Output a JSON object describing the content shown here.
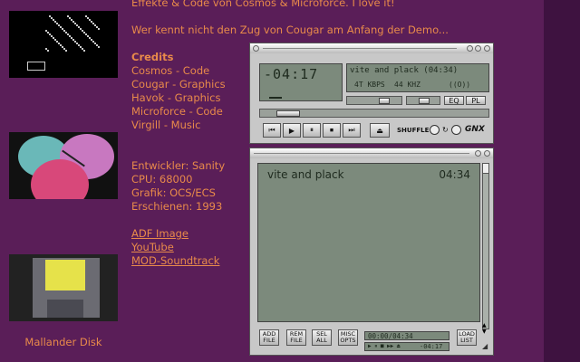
{
  "intro": {
    "line1": "Effekte & Code von Cosmos & Microforce. I love it!",
    "line2": "Wer kennt nicht den Zug von Cougar am Anfang der Demo..."
  },
  "credits": {
    "title": "Credits",
    "items": [
      "Cosmos - Code",
      "Cougar - Graphics",
      "Havok - Graphics",
      "Microforce - Code",
      "Virgill - Music"
    ]
  },
  "info": {
    "items": [
      "Entwickler: Sanity",
      "CPU: 68000",
      "Grafik: OCS/ECS",
      "Erschienen: 1993"
    ]
  },
  "links": [
    "ADF Image",
    "YouTube",
    "MOD-Soundtrack"
  ],
  "thumb_caption": "Mallander Disk",
  "player": {
    "time": "-04:17",
    "song": "vite and plack (04:34)",
    "kbps": "4T KBPS",
    "khz": "44 KHZ",
    "mode": "((O))",
    "eq_label": "EQ",
    "pl_label": "PL",
    "shuffle_label": "SHUFFLE",
    "logo": "GNX",
    "vol_value": 0.72,
    "seek_value": 0.08
  },
  "playlist": {
    "song": "vite and plack",
    "length": "04:34",
    "buttons": [
      {
        "name": "add-file-button",
        "l1": "ADD",
        "l2": "FILE"
      },
      {
        "name": "rem-file-button",
        "l1": "REM",
        "l2": "FILE"
      },
      {
        "name": "sel-all-button",
        "l1": "SEL",
        "l2": "ALL"
      },
      {
        "name": "misc-opts-button",
        "l1": "MISC",
        "l2": "OPTS"
      }
    ],
    "time_info": "00:00/04:34",
    "mini_time": "-04:17",
    "load_l1": "LOAD",
    "load_l2": "LIST"
  },
  "colors": {
    "accent": "#e88a4a",
    "background": "#5a1e58"
  }
}
